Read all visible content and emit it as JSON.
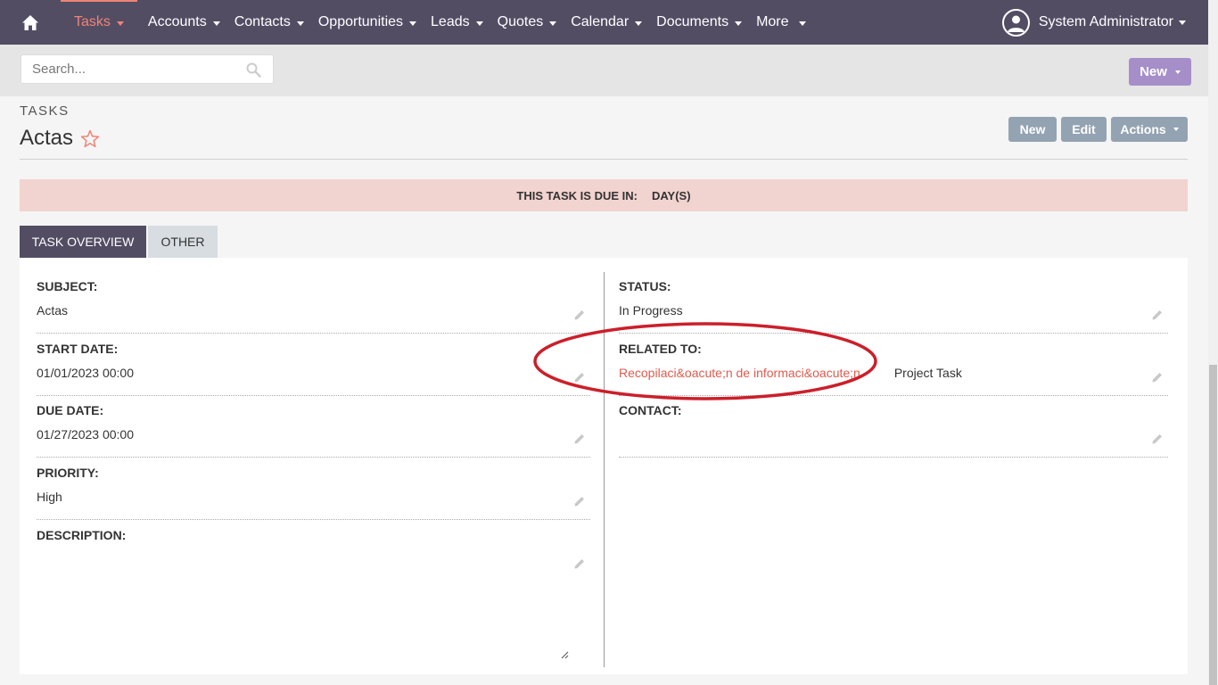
{
  "nav": {
    "items": [
      {
        "label": "Tasks",
        "active": true
      },
      {
        "label": "Accounts"
      },
      {
        "label": "Contacts"
      },
      {
        "label": "Opportunities"
      },
      {
        "label": "Leads"
      },
      {
        "label": "Quotes"
      },
      {
        "label": "Calendar"
      },
      {
        "label": "Documents"
      },
      {
        "label": "More"
      }
    ],
    "user": "System Administrator",
    "accent": "#f08377",
    "bar_color": "#534d64"
  },
  "search": {
    "placeholder": "Search..."
  },
  "create_button": "New",
  "header": {
    "module": "TASKS",
    "title": "Actas",
    "buttons": {
      "new": "New",
      "edit": "Edit",
      "actions": "Actions"
    }
  },
  "banner": {
    "label": "THIS TASK IS DUE IN:",
    "unit": "DAY(S)"
  },
  "tabs": [
    {
      "label": "TASK OVERVIEW",
      "active": true
    },
    {
      "label": "OTHER"
    }
  ],
  "fields": {
    "subject": {
      "label": "SUBJECT:",
      "value": "Actas"
    },
    "start_date": {
      "label": "START DATE:",
      "value": "01/01/2023 00:00"
    },
    "due_date": {
      "label": "DUE DATE:",
      "value": "01/27/2023 00:00"
    },
    "priority": {
      "label": "PRIORITY:",
      "value": "High"
    },
    "description": {
      "label": "DESCRIPTION:",
      "value": ""
    },
    "status": {
      "label": "STATUS:",
      "value": "In Progress"
    },
    "related_to": {
      "label": "RELATED TO:",
      "value": "Recopilaci&oacute;n de informaci&oacute;n",
      "type": "Project Task"
    },
    "contact": {
      "label": "CONTACT:",
      "value": ""
    }
  },
  "icons": {
    "home": "home-icon",
    "search": "search-icon",
    "star": "star-icon",
    "pencil": "pencil-icon",
    "user": "user-circle-icon"
  },
  "annotation_color": "#cc1f2a"
}
